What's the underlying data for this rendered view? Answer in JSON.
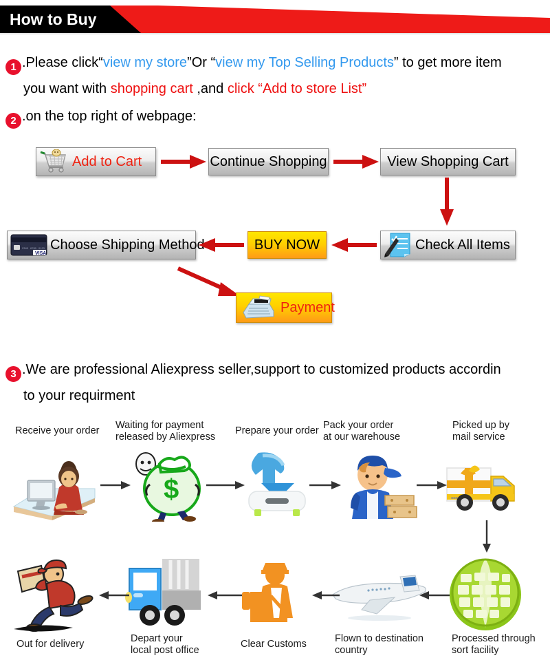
{
  "header": {
    "title": "How to Buy"
  },
  "steps": {
    "one": {
      "number": "1",
      "text_a": ".Please click“",
      "link_1": "view my store",
      "text_b": "”Or “",
      "link_2": "view my Top Selling Products",
      "text_c": "” to get more item",
      "line2_a": "you want with ",
      "line2_red1": "shopping cart",
      "line2_b": " ,and ",
      "line2_red2": "click “Add to store List”"
    },
    "two": {
      "number": "2",
      "text": ".on the top right of webpage:"
    },
    "three": {
      "number": "3",
      "text": ".We are professional Aliexpress seller,support to customized products accordin",
      "line2": "to your requirment"
    }
  },
  "buttons": {
    "add_to_cart": "Add to Cart",
    "continue_shopping": "Continue Shopping",
    "view_shopping_cart": "View Shopping Cart",
    "choose_shipping_method": "Choose Shipping Method",
    "buy_now": "BUY NOW",
    "check_all_items": "Check All Items",
    "payment": "Payment"
  },
  "icons": {
    "cart": "shopping-cart-icon",
    "credit_card": "credit-card-icon",
    "checklist": "checklist-icon",
    "cash_register": "cash-register-icon"
  },
  "colors": {
    "banner_red": "#ee1b18",
    "banner_black": "#000000",
    "badge_red": "#e8112d",
    "link_blue": "#3399ee",
    "text_red": "#ee1111",
    "arrow_red": "#cc1111",
    "buy_now_gradient_start": "#ffe600",
    "buy_now_gradient_end": "#ff9b16",
    "globe_green": "#9acd1e",
    "customs_orange": "#f29222",
    "truck_yellow": "#f5c518"
  },
  "process": {
    "top_row": [
      {
        "label": "Receive your order",
        "icon": "person-at-computer-icon"
      },
      {
        "label": "Waiting for payment\nreleased by Aliexpress",
        "icon": "money-bag-icon"
      },
      {
        "label": "Prepare your order",
        "icon": "download-box-icon"
      },
      {
        "label": "Pack your order\nat our warehouse",
        "icon": "warehouse-worker-icon"
      },
      {
        "label": "Picked up by\nmail service",
        "icon": "mail-truck-icon"
      }
    ],
    "bottom_row": [
      {
        "label": "Out for delivery",
        "icon": "running-courier-icon"
      },
      {
        "label": "Depart your\nlocal post office",
        "icon": "post-truck-icon"
      },
      {
        "label": "Clear Customs",
        "icon": "customs-officer-icon"
      },
      {
        "label": "Flown to destination\ncountry",
        "icon": "airplane-icon"
      },
      {
        "label": "Processed through\nsort facility",
        "icon": "globe-sort-icon"
      }
    ]
  }
}
